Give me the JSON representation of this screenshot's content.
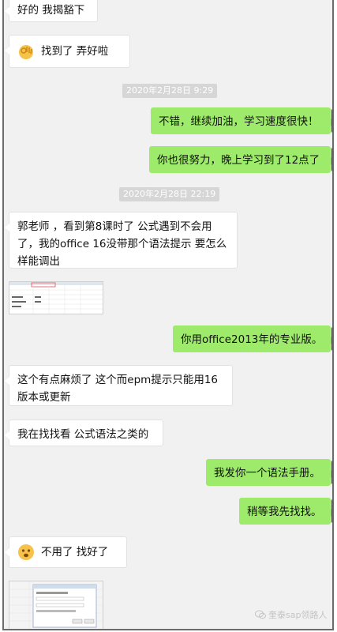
{
  "messages": [
    {
      "id": "m0",
      "side": "left",
      "text": "好的  我揭豁下"
    },
    {
      "id": "m1",
      "side": "left",
      "text": "找到了  弄好啦",
      "emoji": "ok-hand-icon"
    },
    {
      "id": "m2",
      "side": "right",
      "text": "不错，继续加油，学习速度很快！"
    },
    {
      "id": "m3",
      "side": "right",
      "text": "你也很努力，晚上学习到了12点了"
    },
    {
      "id": "m4",
      "side": "left",
      "text": "郭老师  ，看到第8课时了   公式遇到不会用了，我的office 16没带那个语法提示   要怎么样能调出"
    },
    {
      "id": "m5",
      "side": "right",
      "text": "你用office2013年的专业版。"
    },
    {
      "id": "m6",
      "side": "left",
      "text": "这个有点麻烦了  这个而epm提示只能用16版本或更新"
    },
    {
      "id": "m7",
      "side": "left",
      "text": "我在找找看  公式语法之类的"
    },
    {
      "id": "m8",
      "side": "right",
      "text": "我发你一个语法手册。"
    },
    {
      "id": "m9",
      "side": "right",
      "text": "稍等我先找找。"
    },
    {
      "id": "m10",
      "side": "left",
      "text": "不用了 找好了",
      "emoji": "surprised-face-icon"
    }
  ],
  "timestamps": [
    "2020年2月28日 9:29",
    "2020年2月28日 22:19"
  ],
  "watermark": "奎泰sap领路人",
  "colors": {
    "background": "#f1f1f1",
    "left_bubble": "#ffffff",
    "right_bubble": "#9eea6a",
    "timestamp_bg": "#d6d6d6"
  }
}
